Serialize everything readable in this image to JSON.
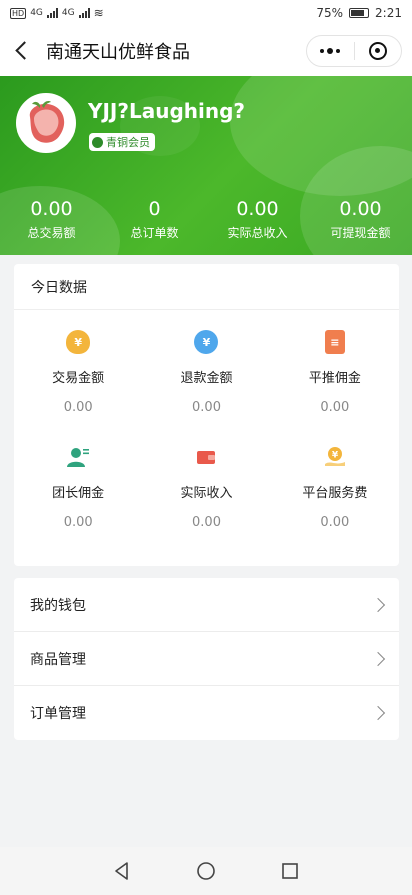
{
  "status_bar": {
    "battery": "75%",
    "time": "2:21",
    "network_a": "4G",
    "network_b": "4G"
  },
  "nav": {
    "title": "南通天山优鲜食品"
  },
  "profile": {
    "name": "YJJ?Laughing?",
    "member_level": "青铜会员"
  },
  "stats": [
    {
      "value": "0.00",
      "label": "总交易额"
    },
    {
      "value": "0",
      "label": "总订单数"
    },
    {
      "value": "0.00",
      "label": "实际总收入"
    },
    {
      "value": "0.00",
      "label": "可提现金额"
    }
  ],
  "today": {
    "title": "今日数据",
    "items": [
      {
        "label": "交易金额",
        "value": "0.00",
        "icon": "money-bag-icon",
        "color": "#f3b53c",
        "glyph": "¥"
      },
      {
        "label": "退款金额",
        "value": "0.00",
        "icon": "refund-icon",
        "color": "#4fa7ec",
        "glyph": "¥"
      },
      {
        "label": "平推佣金",
        "value": "0.00",
        "icon": "clipboard-icon",
        "color": "#f07e4e",
        "glyph": "≡"
      },
      {
        "label": "团长佣金",
        "value": "0.00",
        "icon": "leader-icon",
        "color": "#2fa37e",
        "glyph": "●"
      },
      {
        "label": "实际收入",
        "value": "0.00",
        "icon": "wallet-icon",
        "color": "#e9594b",
        "glyph": "▬"
      },
      {
        "label": "平台服务费",
        "value": "0.00",
        "icon": "service-fee-icon",
        "color": "#f3b53c",
        "glyph": "¥"
      }
    ]
  },
  "menu": [
    {
      "label": "我的钱包"
    },
    {
      "label": "商品管理"
    },
    {
      "label": "订单管理"
    }
  ]
}
